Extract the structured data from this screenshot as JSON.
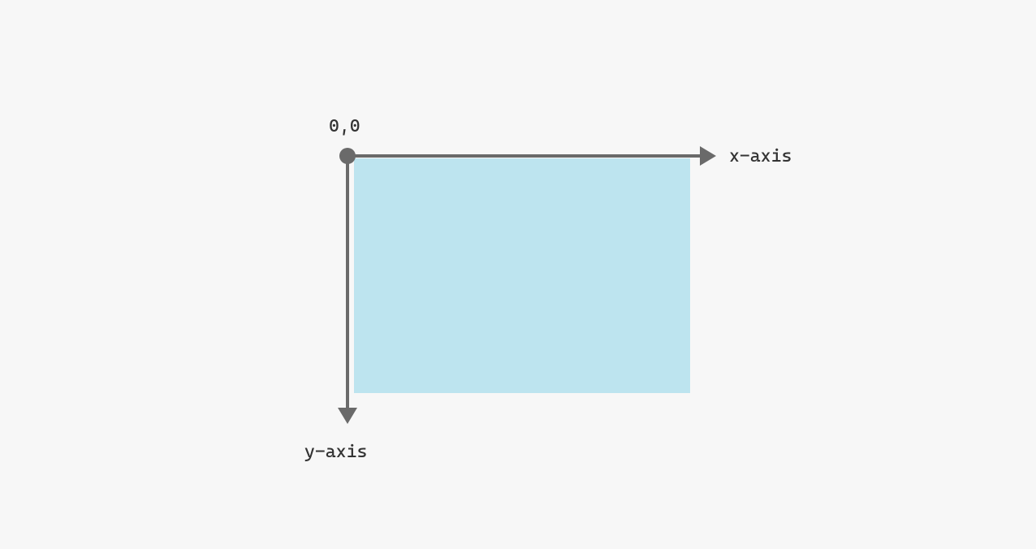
{
  "diagram": {
    "origin_label": "0,0",
    "x_axis_label": "x-axis",
    "y_axis_label": "y-axis",
    "axis_color": "#6a6a6a",
    "viewport_fill": "#bde4ef",
    "background": "#f7f7f7"
  }
}
